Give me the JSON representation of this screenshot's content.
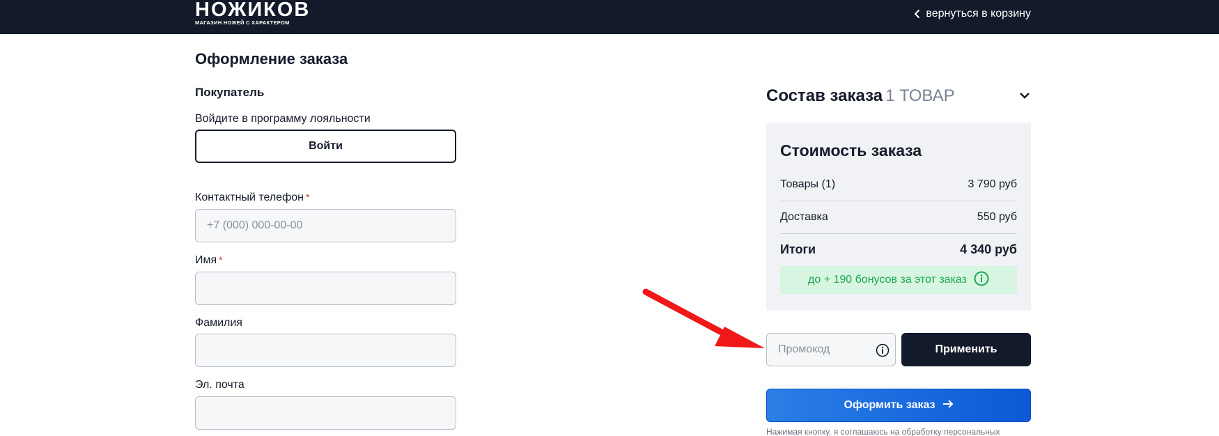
{
  "header": {
    "logo_main": "НОЖИКОВ",
    "logo_sub": "МАГАЗИН НОЖЕЙ С ХАРАКТЕРОМ",
    "back_label": "вернуться в корзину",
    "bg_color": "#131a2a"
  },
  "form": {
    "page_title": "Оформление заказа",
    "section_title": "Покупатель",
    "loyalty_text": "Войдите в программу лояльности",
    "login_label": "Войти",
    "phone_label": "Контактный телефон",
    "phone_placeholder": "+7 (000) 000-00-00",
    "name_label": "Имя",
    "surname_label": "Фамилия",
    "email_label": "Эл. почта",
    "required_mark": "*"
  },
  "order": {
    "title": "Состав заказа",
    "count": "1 ТОВАР",
    "summary_title": "Стоимость заказа",
    "rows": [
      {
        "label": "Товары (1)",
        "value": "3 790 руб"
      },
      {
        "label": "Доставка",
        "value": "550 руб"
      }
    ],
    "total_label": "Итоги",
    "total_value": "4 340 руб",
    "bonus_text": "до + 190 бонусов за этот заказ",
    "promo_placeholder": "Промокод",
    "apply_label": "Применить",
    "submit_label": "Оформить заказ",
    "consent_text": "Нажимая кнопку, я соглашаюсь на обработку персональных",
    "accent_color": "#1a6ae0",
    "bonus_color": "#1aa752"
  }
}
